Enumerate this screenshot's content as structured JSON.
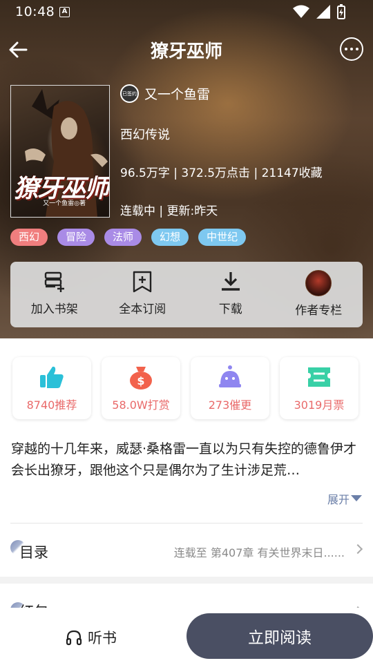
{
  "status_bar": {
    "time": "10:48",
    "notification_badge": "A"
  },
  "header": {
    "title": "獠牙巫师"
  },
  "book": {
    "cover_title": "獠牙巫师",
    "cover_author_text": "又一个鱼雷◎著",
    "author_badge": "已签约",
    "author": "又一个鱼雷",
    "genre": "西幻传说",
    "stats": "96.5万字 | 372.5万点击 | 21147收藏",
    "status": "连载中 | 更新:昨天"
  },
  "tags": [
    {
      "label": "西幻",
      "color": "#f07e7e"
    },
    {
      "label": "冒险",
      "color": "#a98be6"
    },
    {
      "label": "法师",
      "color": "#a98be6"
    },
    {
      "label": "幻想",
      "color": "#7ec8f0"
    },
    {
      "label": "中世纪",
      "color": "#7ec8f0"
    }
  ],
  "actions": [
    {
      "label": "加入书架",
      "icon": "add-to-shelf-icon"
    },
    {
      "label": "全本订阅",
      "icon": "subscribe-icon"
    },
    {
      "label": "下载",
      "icon": "download-icon"
    },
    {
      "label": "作者专栏",
      "icon": "author-avatar"
    }
  ],
  "metrics": [
    {
      "label": "8740推荐",
      "icon": "thumbs-up-icon",
      "color": "#2bc0d8"
    },
    {
      "label": "58.0W打赏",
      "icon": "money-bag-icon",
      "color": "#f2624c"
    },
    {
      "label": "273催更",
      "icon": "bell-character-icon",
      "color": "#8f86f0"
    },
    {
      "label": "3019月票",
      "icon": "ticket-icon",
      "color": "#38d0a6"
    }
  ],
  "synopsis": "穿越的十几年来，威瑟·桑格雷一直以为只有失控的德鲁伊才会长出獠牙，跟他这个只是偶尔为了生计涉足荒…",
  "expand_label": "展开",
  "toc": {
    "label": "目录",
    "info": "连载至 第407章 有关世界末日......"
  },
  "redpack": {
    "label": "红包"
  },
  "bottom": {
    "listen_label": "听书",
    "read_label": "立即阅读"
  }
}
